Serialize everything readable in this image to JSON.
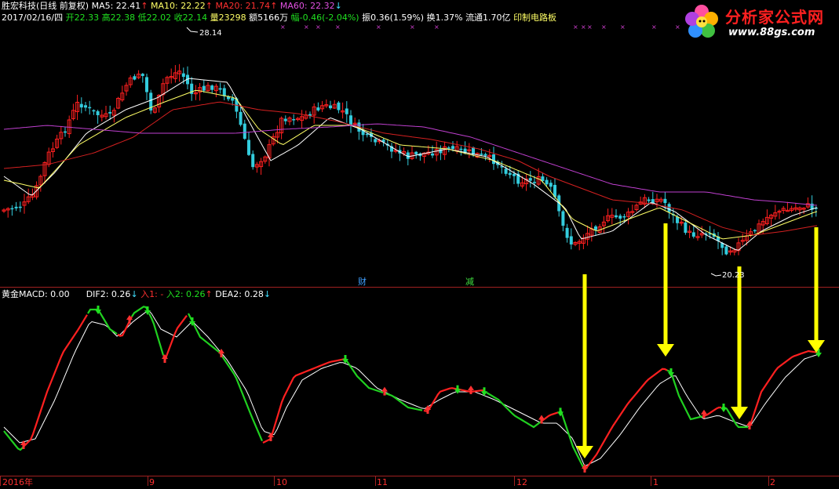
{
  "header": {
    "stock_name": "胜宏科技(日线 前复权)",
    "ma5": "MA5: 22.41",
    "ma10": "MA10: 22.22",
    "ma20": "MA20: 21.74",
    "ma60": "MA60: 22.32",
    "date": "2017/02/16/四",
    "open": "开22.33",
    "high": "高22.38",
    "low": "低22.02",
    "close": "收22.14",
    "volume": "量23298",
    "amount": "额5166万",
    "change": "幅-0.46(-2.04%)",
    "amplitude": "振0.36(1.59%)",
    "turnover": "换1.37%",
    "float_mv": "流通1.70亿",
    "sector": "印制电路板"
  },
  "logo": {
    "name": "分析家公式网",
    "url": "www.88gs.com"
  },
  "indicator_header": {
    "name": "黄金MACD",
    "value": ": 0.00",
    "dif2": "DIF2: 0.26",
    "in1": "入1: -",
    "in2": "入2: 0.26",
    "dea2": "DEA2: 0.28"
  },
  "markers": {
    "cai": "财",
    "jian": "减",
    "high_label": "28.14",
    "low_label": "20.23"
  },
  "colors": {
    "up": "#ff2020",
    "down": "#33ccdd",
    "ma5": "#ffffff",
    "ma10": "#ffff66",
    "ma20": "#d42020",
    "ma60": "#c040d0",
    "macd_pos": "#e01818",
    "macd_neg": "#40c0d8",
    "macd_mag": "#c030c0",
    "arrow": "#ffff00",
    "dif_up": "#ff2020",
    "dif_down": "#20d020"
  },
  "chart_data": {
    "type": "candlestick",
    "x_axis_labels": [
      "2016年",
      "9",
      "10",
      "11",
      "12",
      "1",
      "2"
    ],
    "price_markers": {
      "high": 28.14,
      "low": 20.23
    },
    "indicator": "黄金MACD"
  }
}
